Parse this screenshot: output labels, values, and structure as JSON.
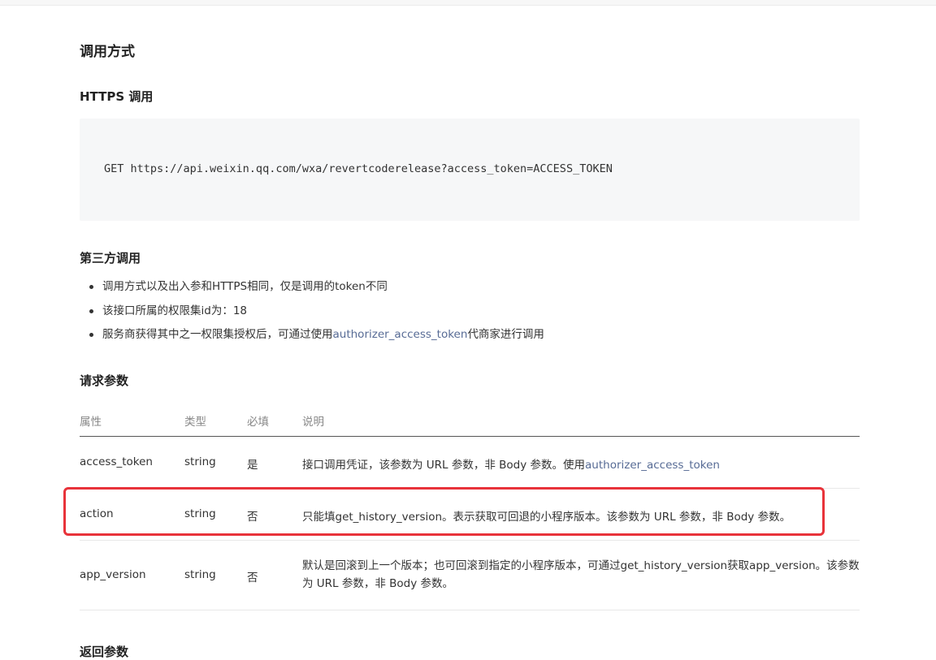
{
  "headings": {
    "call_method": "调用方式",
    "https_call": "HTTPS 调用",
    "third_party_call": "第三方调用",
    "request_params": "请求参数",
    "return_params": "返回参数"
  },
  "code": {
    "request_line": "GET https://api.weixin.qq.com/wxa/revertcoderelease?access_token=ACCESS_TOKEN"
  },
  "third_party": {
    "bullets": [
      {
        "text": "调用方式以及出入参和HTTPS相同，仅是调用的token不同"
      },
      {
        "text": "该接口所属的权限集id为：18"
      },
      {
        "before": "服务商获得其中之一权限集授权后，可通过使用",
        "link": "authorizer_access_token",
        "after": "代商家进行调用"
      }
    ]
  },
  "table": {
    "headers": [
      "属性",
      "类型",
      "必填",
      "说明"
    ],
    "rows": [
      {
        "name": "access_token",
        "type": "string",
        "required": "是",
        "desc_before": "接口调用凭证，该参数为 URL 参数，非 Body 参数。使用",
        "desc_link": "authorizer_access_token"
      },
      {
        "name": "action",
        "type": "string",
        "required": "否",
        "desc": "只能填get_history_version。表示获取可回退的小程序版本。该参数为 URL 参数，非 Body 参数。"
      },
      {
        "name": "app_version",
        "type": "string",
        "required": "否",
        "desc": "默认是回滚到上一个版本；也可回滚到指定的小程序版本，可通过get_history_version获取app_version。该参数为 URL 参数，非 Body 参数。"
      }
    ]
  },
  "colors": {
    "link": "#576b95",
    "highlight_border": "#e8333a",
    "code_bg": "#f6f7f8"
  }
}
